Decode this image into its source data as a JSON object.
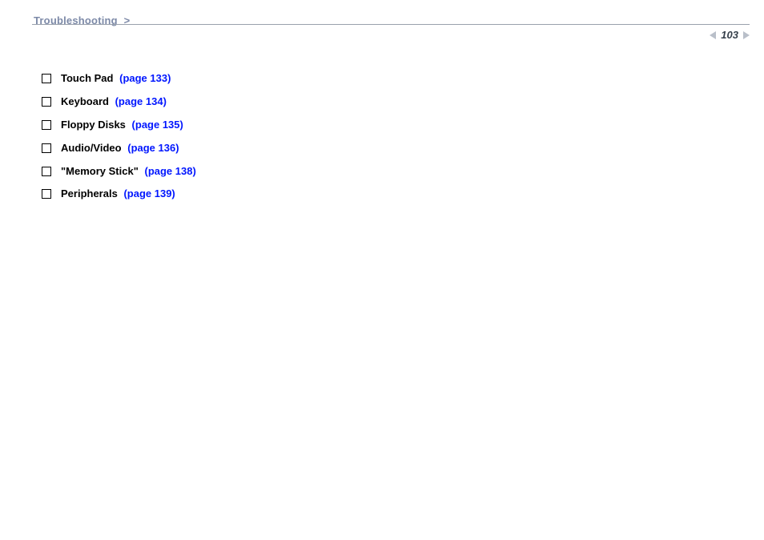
{
  "header": {
    "breadcrumb": "Troubleshooting",
    "breadcrumb_sep": ">"
  },
  "pagenav": {
    "page_number": "103"
  },
  "toc": {
    "items": [
      {
        "label": "Touch Pad",
        "pagelink": "(page 133)"
      },
      {
        "label": "Keyboard",
        "pagelink": "(page 134)"
      },
      {
        "label": "Floppy Disks",
        "pagelink": "(page 135)"
      },
      {
        "label": "Audio/Video",
        "pagelink": "(page 136)"
      },
      {
        "label": "\"Memory Stick\"",
        "pagelink": "(page 138)"
      },
      {
        "label": "Peripherals",
        "pagelink": "(page 139)"
      }
    ]
  }
}
